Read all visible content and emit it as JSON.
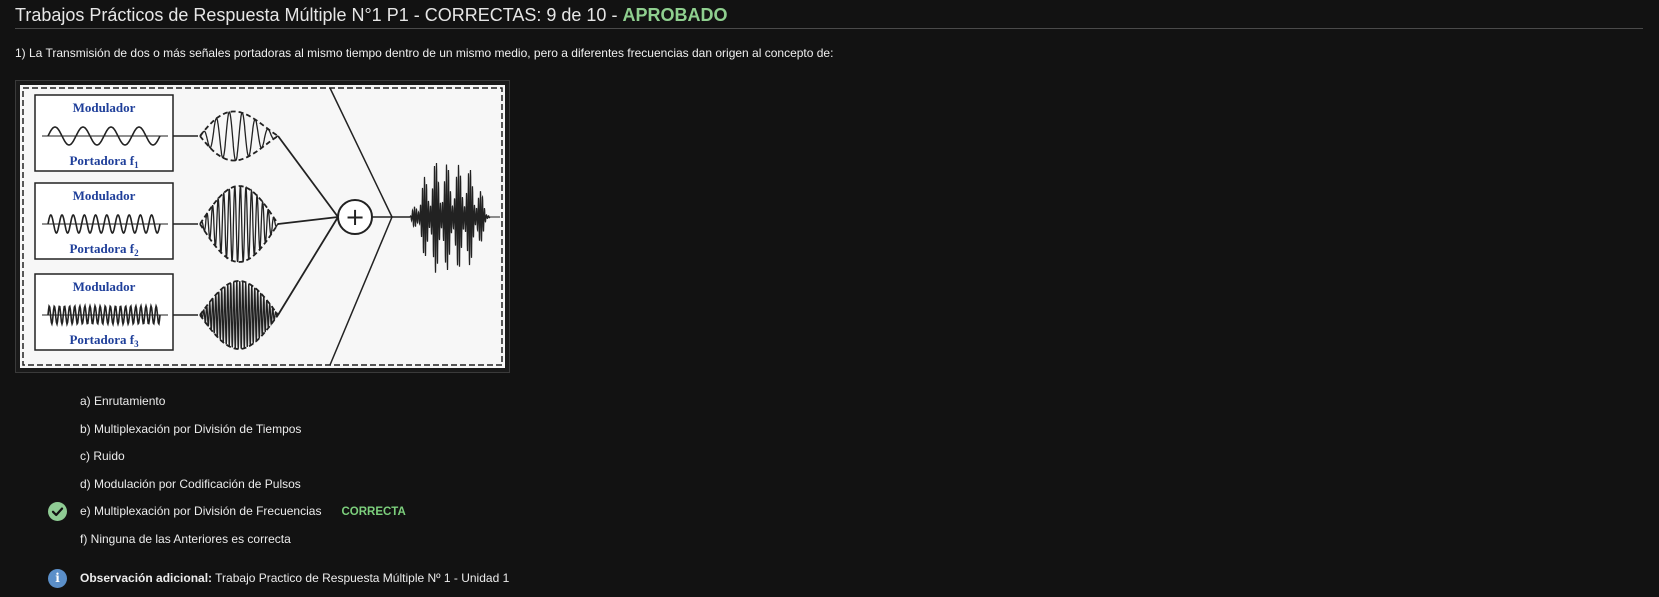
{
  "header": {
    "title": "Trabajos Prácticos de Respuesta Múltiple N°1 P1 - CORRECTAS: 9 de 10 - ",
    "status": "APROBADO",
    "status_color": "#8fcf8f"
  },
  "question": {
    "text": "1) La Transmisión de dos o más señales portadoras al mismo tiempo dentro de un mismo medio, pero a diferentes frecuencias dan origen al concepto de:"
  },
  "figure": {
    "blocks": [
      {
        "top": "Modulador",
        "bottom": "Portadora f",
        "sub": "1"
      },
      {
        "top": "Modulador",
        "bottom": "Portadora f",
        "sub": "2"
      },
      {
        "top": "Modulador",
        "bottom": "Portadora f",
        "sub": "3"
      }
    ],
    "sum_symbol": "+"
  },
  "options": [
    {
      "label": "a) Enrutamiento",
      "correct": false
    },
    {
      "label": "b) Multiplexación por División de Tiempos",
      "correct": false
    },
    {
      "label": "c) Ruido",
      "correct": false
    },
    {
      "label": "d) Modulación por Codificación de Pulsos",
      "correct": false
    },
    {
      "label": "e) Multiplexación por División de Frecuencias",
      "correct": true
    },
    {
      "label": "f) Ninguna de las Anteriores es correcta",
      "correct": false
    }
  ],
  "correct_tag": "CORRECTA",
  "observation": {
    "label": "Observación adicional:",
    "text": " Trabajo Practico de Respuesta Múltiple Nº 1 - Unidad 1"
  },
  "icons": {
    "check": "check-circle-icon",
    "info": "info-circle-icon"
  }
}
